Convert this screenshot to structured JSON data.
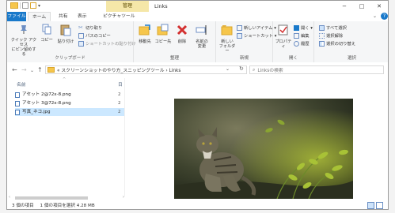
{
  "window": {
    "title": "Links",
    "context_tab": "管理",
    "btn_min": "−",
    "btn_max": "□",
    "btn_close": "✕"
  },
  "tabs": {
    "file": "ファイル",
    "home": "ホーム",
    "share": "共有",
    "view": "表示",
    "picture_tools": "ピクチャツール"
  },
  "ribbon": {
    "clipboard": {
      "pin": "クイック アクセス\nにピン留めする",
      "copy": "コピー",
      "paste": "貼り付け",
      "cut": "切り取り",
      "copy_path": "パスのコピー",
      "paste_shortcut": "ショートカットの貼り付け",
      "label": "クリップボード"
    },
    "organize": {
      "move_to": "移動先",
      "copy_to": "コピー先",
      "delete": "削除",
      "rename": "名前の\n変更",
      "label": "整理"
    },
    "new": {
      "new_folder": "新しい\nフォルダー",
      "new_item": "新しいアイテム ▾",
      "shortcut": "ショートカット ▾",
      "label": "新規"
    },
    "open": {
      "properties": "プロパティ",
      "open": "開く ▾",
      "edit": "編集",
      "history": "履歴",
      "label": "開く"
    },
    "select": {
      "select_all": "すべて選択",
      "select_none": "選択解除",
      "invert": "選択の切り替え",
      "label": "選択"
    }
  },
  "address": {
    "path": "« スクリーンショットのやり方_スニッピングツール › Links",
    "search_placeholder": "Linksの検索"
  },
  "list": {
    "col_name": "名前",
    "col_date": "日",
    "files": [
      {
        "name": "アセット 2@72x-8.png",
        "date": "2"
      },
      {
        "name": "アセット 3@72x-8.png",
        "date": "2"
      },
      {
        "name": "写真_ネコ.jpg",
        "date": "2"
      }
    ]
  },
  "status": {
    "count": "3 個の項目",
    "selection": "1 個の項目を選択  4.28 MB"
  }
}
